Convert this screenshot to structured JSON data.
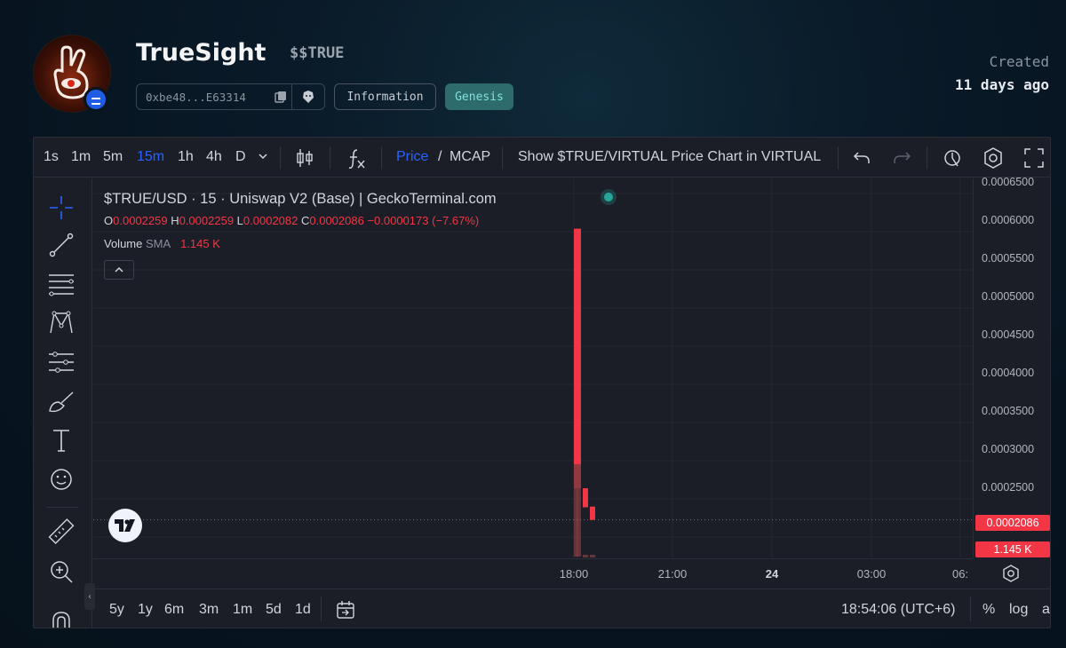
{
  "header": {
    "name": "TrueSight",
    "ticker": "$$TRUE",
    "address": "0xbe48...E63314",
    "info_label": "Information",
    "genesis_label": "Genesis",
    "created_label": "Created",
    "created_value": "11 days ago"
  },
  "toolbar": {
    "intervals": [
      "1s",
      "1m",
      "5m",
      "15m",
      "1h",
      "4h",
      "D"
    ],
    "active_interval": "15m",
    "price_label": "Price",
    "slash": "/",
    "mcap_label": "MCAP",
    "show_chart_label": "Show $TRUE/VIRTUAL Price Chart in VIRTUAL"
  },
  "legend": {
    "title": "$TRUE/USD · 15 · Uniswap V2 (Base) | GeckoTerminal.com",
    "o_key": "O",
    "o_val": "0.0002259",
    "h_key": "H",
    "h_val": "0.0002259",
    "l_key": "L",
    "l_val": "0.0002082",
    "c_key": "C",
    "c_val": "0.0002086",
    "change": "−0.0000173 (−7.67%)",
    "volume_label": "Volume",
    "sma_label": "SMA",
    "volume_value": "1.145 K"
  },
  "price_axis": {
    "labels": [
      "0.0006500",
      "0.0006000",
      "0.0005500",
      "0.0005000",
      "0.0004500",
      "0.0004000",
      "0.0003500",
      "0.0003000",
      "0.0002500"
    ],
    "current_price": "0.0002086",
    "current_volume": "1.145 K"
  },
  "time_axis": {
    "labels": [
      "18:00",
      "21:00",
      "24",
      "03:00",
      "06:"
    ]
  },
  "bottom_bar": {
    "ranges": [
      "5y",
      "1y",
      "6m",
      "3m",
      "1m",
      "5d",
      "1d"
    ],
    "clock": "18:54:06 (UTC+6)",
    "percent_label": "%",
    "log_label": "log",
    "auto_label": "auto"
  },
  "chart_data": {
    "type": "candlestick",
    "y_range": [
      0.00016,
      0.00065
    ],
    "candles": [
      {
        "time": "18:00",
        "open": 0.00025,
        "high": 0.00059,
        "low": 0.00016,
        "close": 0.00059,
        "direction": "down"
      },
      {
        "time": "18:15",
        "open": 0.00025,
        "high": 0.00025,
        "low": 0.000225,
        "close": 0.000225,
        "direction": "down"
      },
      {
        "time": "18:30",
        "open": 0.0002259,
        "high": 0.0002259,
        "low": 0.0002082,
        "close": 0.0002086,
        "direction": "down"
      }
    ],
    "current_price": 0.0002086,
    "colors": {
      "down": "#f23645",
      "up": "#26a69a"
    }
  }
}
